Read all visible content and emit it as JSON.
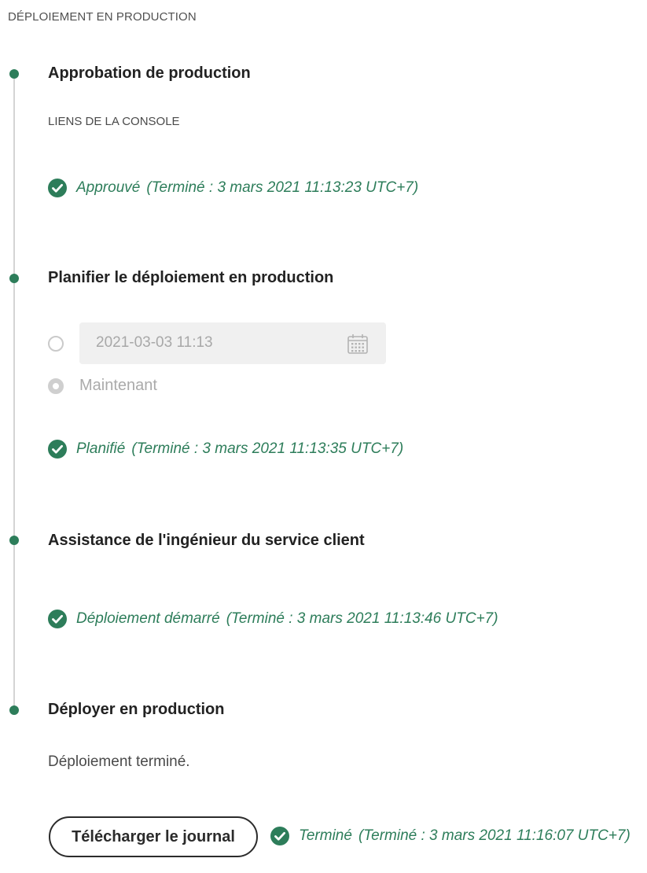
{
  "section_title": "DÉPLOIEMENT EN PRODUCTION",
  "colors": {
    "accent_green": "#2d7d5a",
    "timeline_gray": "#d4d4d4"
  },
  "steps": [
    {
      "title": "Approbation de production",
      "sub_label": "LIENS DE LA CONSOLE",
      "status": {
        "icon": "checkmark-circle-icon",
        "label": "Approuvé",
        "detail": "(Terminé : 3 mars 2021 11:13:23 UTC+7)"
      }
    },
    {
      "title": "Planifier le déploiement en production",
      "schedule": {
        "options": [
          {
            "selected": false
          },
          {
            "label": "Maintenant",
            "selected": true
          }
        ],
        "date_value": "2021-03-03 11:13",
        "calendar_icon": "calendar-icon"
      },
      "status": {
        "icon": "checkmark-circle-icon",
        "label": "Planifié",
        "detail": "(Terminé : 3 mars 2021 11:13:35 UTC+7)"
      }
    },
    {
      "title": "Assistance de l'ingénieur du service client",
      "status": {
        "icon": "checkmark-circle-icon",
        "label": "Déploiement démarré",
        "detail": "(Terminé : 3 mars 2021 11:13:46 UTC+7)"
      }
    },
    {
      "title": "Déployer en production",
      "message": "Déploiement terminé.",
      "button_label": "Télécharger le journal",
      "status": {
        "icon": "checkmark-circle-icon",
        "label": "Terminé",
        "detail": "(Terminé : 3 mars 2021 11:16:07 UTC+7)"
      }
    }
  ]
}
